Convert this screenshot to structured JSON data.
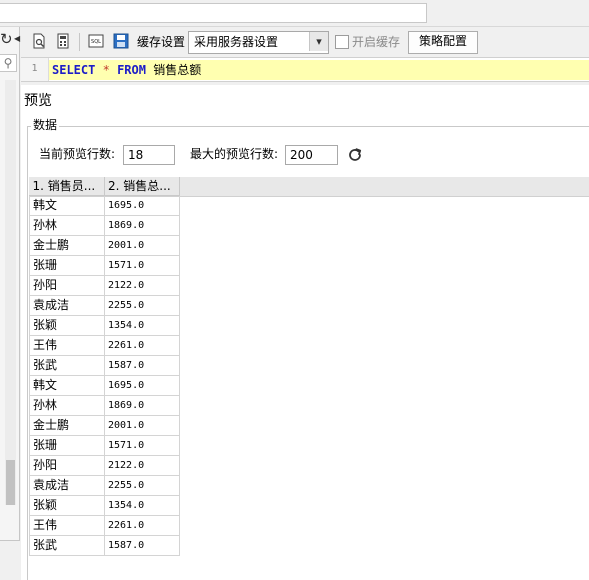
{
  "toolbar": {
    "cache_label": "缓存设置",
    "cache_select_value": "采用服务器设置",
    "enable_cache_label": "开启缓存",
    "enable_cache_checked": false,
    "strategy_button": "策略配置"
  },
  "sql": {
    "line_number": "1",
    "kw_select": "SELECT",
    "star": "*",
    "kw_from": "FROM",
    "table": "销售总额"
  },
  "preview": {
    "title": "预览",
    "group_label": "数据",
    "current_rows_label": "当前预览行数:",
    "current_rows_value": "18",
    "max_rows_label": "最大的预览行数:",
    "max_rows_value": "200"
  },
  "table": {
    "columns": [
      "1. 销售员...",
      "2. 销售总..."
    ],
    "rows": [
      [
        "韩文",
        "1695.0"
      ],
      [
        "孙林",
        "1869.0"
      ],
      [
        "金士鹏",
        "2001.0"
      ],
      [
        "张珊",
        "1571.0"
      ],
      [
        "孙阳",
        "2122.0"
      ],
      [
        "袁成洁",
        "2255.0"
      ],
      [
        "张颖",
        "1354.0"
      ],
      [
        "王伟",
        "2261.0"
      ],
      [
        "张武",
        "1587.0"
      ],
      [
        "韩文",
        "1695.0"
      ],
      [
        "孙林",
        "1869.0"
      ],
      [
        "金士鹏",
        "2001.0"
      ],
      [
        "张珊",
        "1571.0"
      ],
      [
        "孙阳",
        "2122.0"
      ],
      [
        "袁成洁",
        "2255.0"
      ],
      [
        "张颖",
        "1354.0"
      ],
      [
        "王伟",
        "2261.0"
      ],
      [
        "张武",
        "1587.0"
      ]
    ]
  },
  "colors": {
    "sql_keyword": "#1c1cc8",
    "sql_highlight": "#ffffb0",
    "refresh_icon": "#333333"
  }
}
